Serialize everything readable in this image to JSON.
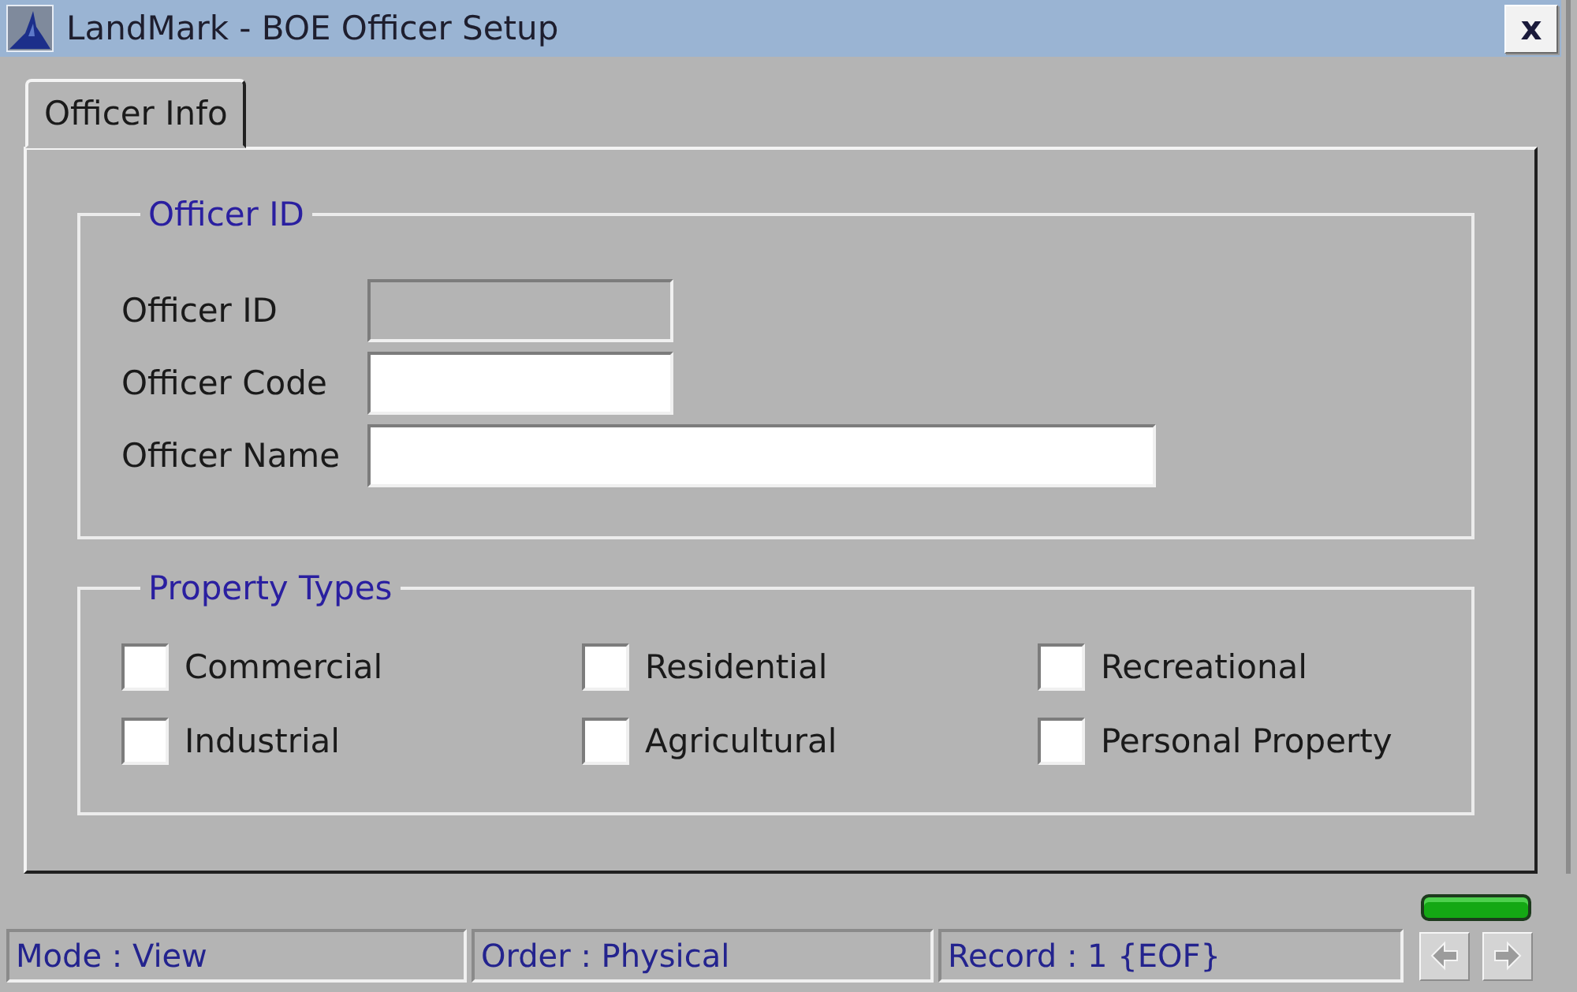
{
  "window": {
    "title": "LandMark - BOE Officer Setup",
    "close_button": "x"
  },
  "tabs": [
    {
      "label": "Officer Info",
      "selected": true
    }
  ],
  "officer_id_group": {
    "title": "Officer ID",
    "fields": [
      {
        "label": "Officer ID",
        "disabled": true
      },
      {
        "label": "Officer Code",
        "disabled": false
      },
      {
        "label": "Officer Name",
        "disabled": false
      }
    ]
  },
  "property_types_group": {
    "title": "Property Types",
    "options": [
      {
        "label": "Commercial",
        "checked": false
      },
      {
        "label": "Residential",
        "checked": false
      },
      {
        "label": "Recreational",
        "checked": false
      },
      {
        "label": "Industrial",
        "checked": false
      },
      {
        "label": "Agricultural",
        "checked": false
      },
      {
        "label": "Personal Property",
        "checked": false
      }
    ]
  },
  "status_light": {
    "on": true
  },
  "status_bar": {
    "panels": [
      "Mode : View",
      "Order : Physical",
      "Record : 1 {EOF}"
    ],
    "navigation": [
      {
        "kind": "previous",
        "disabled": true
      },
      {
        "kind": "next",
        "disabled": true
      }
    ]
  }
}
